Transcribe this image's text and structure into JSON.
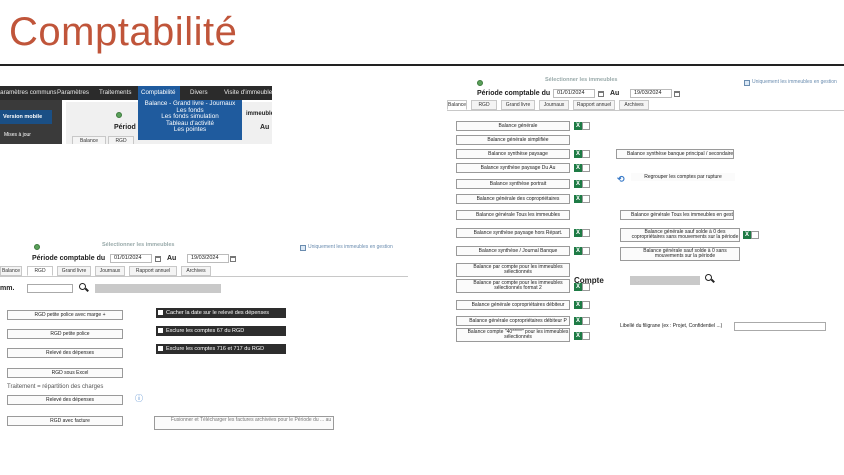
{
  "slide": {
    "title": "Comptabilité"
  },
  "panel_menu": {
    "menubar": [
      "Paramètres communs",
      "Paramètres",
      "Traitements",
      "Comptabilité",
      "Divers",
      "Visite d'immeuble"
    ],
    "active_menu": "Comptabilité",
    "sidebar": {
      "mobile_version": "Version mobile",
      "updates": "Mises à jour"
    },
    "dropdown_items": [
      "Balance - Grand livre - Journaux",
      "Les fonds",
      "Les fonds simulation",
      "Tableau d'activité",
      "Les pointes"
    ],
    "partial_period": "Périod",
    "partial_au": "Au",
    "partial_immeubles": "immeuble",
    "partial_tabs": [
      "Balance",
      "RGD"
    ]
  },
  "panel_right": {
    "select_title": "Sélectionner les immeubles",
    "only_managed": "Uniquement les immeubles en gestion",
    "period_label": "Période comptable du",
    "date_from": "01/01/2024",
    "au": "Au",
    "date_to": "19/03/2024",
    "tabs": [
      "Balance",
      "RGD",
      "Grand livre",
      "Journaux",
      "Rapport annuel",
      "Archives"
    ],
    "left_buttons": [
      "Balance générale",
      "Balance générale simplifiée",
      "Balance synthèse paysage",
      "Balance synthèse paysage Du Au",
      "Balance synthèse portrait",
      "Balance générale des copropriétaires",
      "Balance générale Tous les immeubles",
      "Balance synthèse paysage hors Répart.",
      "Balance synthèse / Journal Banque",
      "Balance par compte pour les immeubles sélectionnés",
      "Balance par compte pour les immeubles sélectionnés format 2",
      "Balance générale copropriétaires débiteur",
      "Balance générale copropriétaires débiteur P",
      "Balance compte \"40*****\" pour les immeubles sélectionnés"
    ],
    "right_buttons": [
      "Balance synthèse banque principal / secondaire",
      "Regrouper les comptes par rupture",
      "Balance générale Tous les immeubles en gestion",
      "Balance générale sauf solde à 0 des copropriétaires sans mouvements sur la période",
      "Balance générale sauf solde à 0 sans mouvements sur la période"
    ],
    "compte_label": "Compte",
    "watermark_label": "Libellé du filigrane (ex : Projet, Confidentiel ...)"
  },
  "panel_rgd": {
    "select_title": "Sélectionner les immeubles",
    "only_managed": "Uniquement les immeubles en gestion",
    "period_label": "Période comptable du",
    "date_from": "01/01/2024",
    "au": "Au",
    "date_to": "19/03/2024",
    "tabs": [
      "Balance",
      "RGD",
      "Grand livre",
      "Journaux",
      "Rapport annuel",
      "Archives"
    ],
    "imm_label": "mm.",
    "left_buttons": [
      "RGD petite police avec marge +",
      "RGD petite police",
      "Relevé des dépenses",
      "RGD sous Excel"
    ],
    "section_label": "Traitement = répartition des charges",
    "section_buttons": [
      "Relevé des dépenses",
      "RGD avec facture"
    ],
    "options": [
      "Cacher la date sur le relevé des dépenses",
      "Exclure les comptes 67 du RGD",
      "Exclure les comptes 716 et 717 du RGD"
    ],
    "merge_button": "Fusionner et Télécharger les factures archivées pour le Période du ... au"
  },
  "colors": {
    "title": "#c0553a",
    "menu_active": "#1f5b9e",
    "excel_green": "#1e7b45"
  }
}
